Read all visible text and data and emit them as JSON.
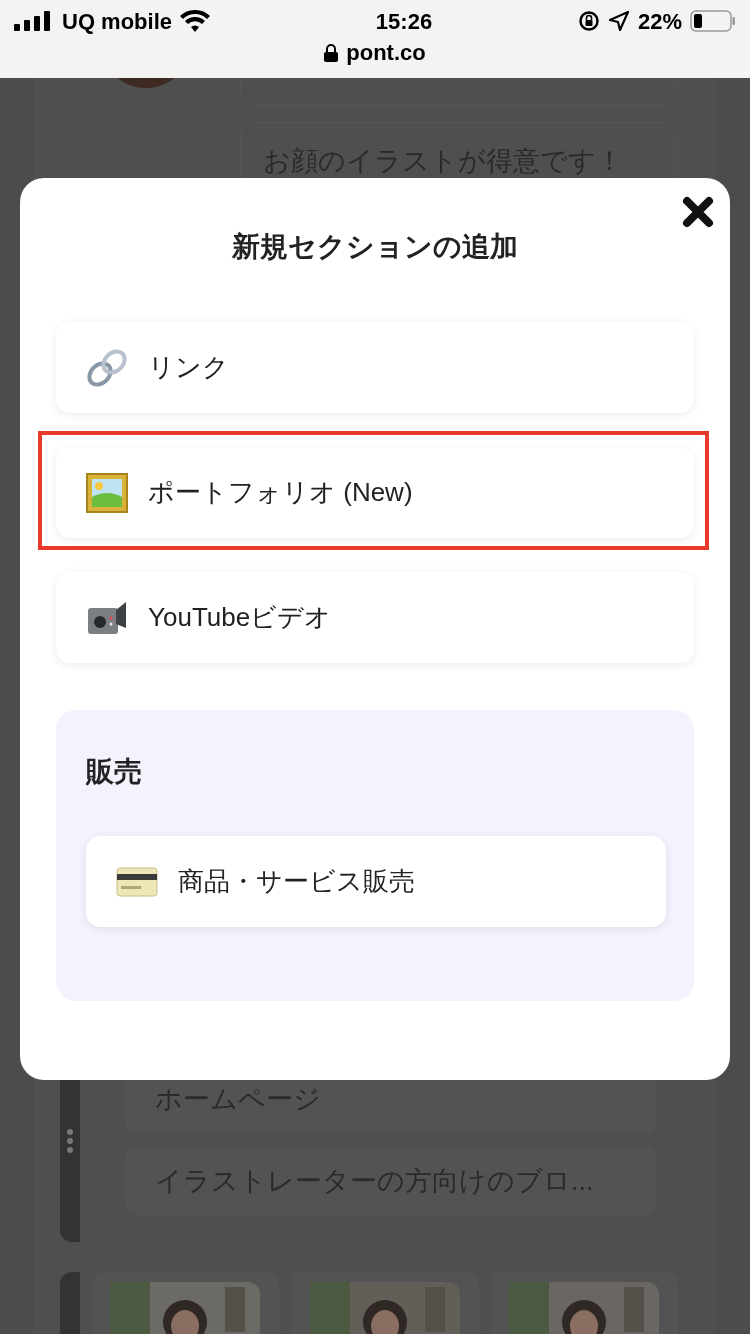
{
  "status_bar": {
    "carrier": "UQ mobile",
    "time": "15:26",
    "battery": "22%",
    "url": "pont.co"
  },
  "background_page": {
    "bio": "お顔のイラストが得意です！",
    "links": [
      "ホームページ",
      "イラストレーターの方向けのブロ..."
    ],
    "portfolio": [
      {
        "kind": "picture"
      },
      {
        "kind": "picture"
      },
      {
        "kind": "picture"
      }
    ]
  },
  "modal": {
    "title": "新規セクションの追加",
    "items": [
      {
        "kind": "link",
        "label": "リンク",
        "highlighted": false
      },
      {
        "kind": "portfolio",
        "label": "ポートフォリオ (New)",
        "highlighted": true
      },
      {
        "kind": "video",
        "label": "YouTubeビデオ",
        "highlighted": false
      }
    ],
    "sale_section": {
      "heading": "販売",
      "items": [
        {
          "kind": "card",
          "label": "商品・サービス販売",
          "highlighted": false
        }
      ]
    }
  }
}
